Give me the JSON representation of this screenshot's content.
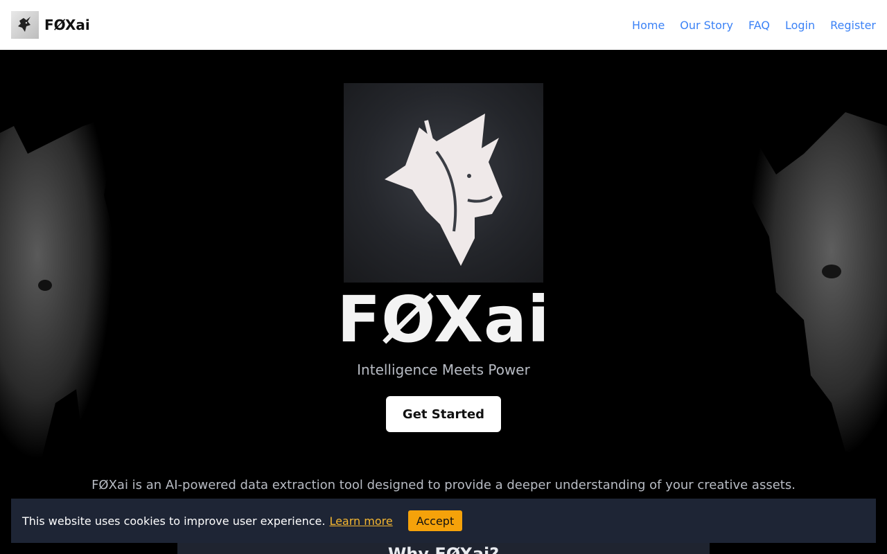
{
  "header": {
    "brand": "FØXai",
    "nav": [
      "Home",
      "Our Story",
      "FAQ",
      "Login",
      "Register"
    ]
  },
  "hero": {
    "title": "FØXai",
    "subtitle": "Intelligence Meets Power",
    "cta": "Get Started",
    "description": "FØXai is an AI-powered data extraction tool designed to provide a deeper understanding of your creative assets."
  },
  "cookie": {
    "text": "This website uses cookies to improve user experience.",
    "link": "Learn more",
    "accept": "Accept"
  },
  "section": {
    "why_title": "Why FØXai?"
  },
  "colors": {
    "link": "#3b82f6",
    "banner": "#1e2535",
    "accept": "#f5a20a",
    "accent_link": "#f5b731"
  }
}
